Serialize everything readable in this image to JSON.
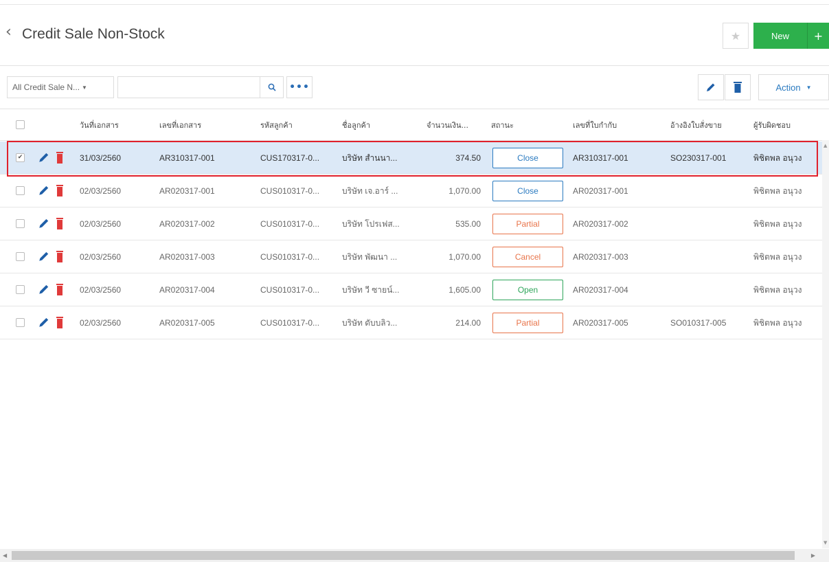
{
  "header": {
    "back_icon": "chevron-left-icon",
    "title": "Credit Sale Non-Stock",
    "star_icon": "star-icon",
    "new_label": "New",
    "plus_label": "+"
  },
  "toolbar": {
    "filter_value": "All Credit Sale N...",
    "search_value": "",
    "more_label": "•••",
    "action_label": "Action"
  },
  "table": {
    "columns": [
      "วันที่เอกสาร",
      "เลขที่เอกสาร",
      "รหัสลูกค้า",
      "ชื่อลูกค้า",
      "จำนวนเงิน...",
      "สถานะ",
      "เลขที่ใบกำกับ",
      "อ้างอิงใบสั่งขาย",
      "ผู้รับผิดชอบ"
    ],
    "rows": [
      {
        "selected": true,
        "date": "31/03/2560",
        "doc_no": "AR310317-001",
        "cust_code": "CUS170317-0...",
        "cust_name": "บริษัท สำนนา...",
        "amount": "374.50",
        "status": "Close",
        "invoice": "AR310317-001",
        "so_ref": "SO230317-001",
        "owner": "พิชิตพล อนุวง"
      },
      {
        "selected": false,
        "date": "02/03/2560",
        "doc_no": "AR020317-001",
        "cust_code": "CUS010317-0...",
        "cust_name": "บริษัท เจ.อาร์ ...",
        "amount": "1,070.00",
        "status": "Close",
        "invoice": "AR020317-001",
        "so_ref": "",
        "owner": "พิชิตพล อนุวง"
      },
      {
        "selected": false,
        "date": "02/03/2560",
        "doc_no": "AR020317-002",
        "cust_code": "CUS010317-0...",
        "cust_name": "บริษัท โปรเฟส...",
        "amount": "535.00",
        "status": "Partial",
        "invoice": "AR020317-002",
        "so_ref": "",
        "owner": "พิชิตพล อนุวง"
      },
      {
        "selected": false,
        "date": "02/03/2560",
        "doc_no": "AR020317-003",
        "cust_code": "CUS010317-0...",
        "cust_name": "บริษัท พัฒนา ...",
        "amount": "1,070.00",
        "status": "Cancel",
        "invoice": "AR020317-003",
        "so_ref": "",
        "owner": "พิชิตพล อนุวง"
      },
      {
        "selected": false,
        "date": "02/03/2560",
        "doc_no": "AR020317-004",
        "cust_code": "CUS010317-0...",
        "cust_name": "บริษัท วี ซายน์...",
        "amount": "1,605.00",
        "status": "Open",
        "invoice": "AR020317-004",
        "so_ref": "",
        "owner": "พิชิตพล อนุวง"
      },
      {
        "selected": false,
        "date": "02/03/2560",
        "doc_no": "AR020317-005",
        "cust_code": "CUS010317-0...",
        "cust_name": "บริษัท ดับบลิว...",
        "amount": "214.00",
        "status": "Partial",
        "invoice": "AR020317-005",
        "so_ref": "SO010317-005",
        "owner": "พิชิตพล อนุวง"
      }
    ]
  },
  "colors": {
    "accent_green": "#2db04c",
    "selected_row": "#dce9f7",
    "highlight_border": "#e0202b",
    "status_close": "#2a7ac0",
    "status_partial": "#e8744a",
    "status_cancel": "#e8744a",
    "status_open": "#2ea55a",
    "edit_icon": "#1f5fa8",
    "delete_icon": "#e03a3a"
  }
}
